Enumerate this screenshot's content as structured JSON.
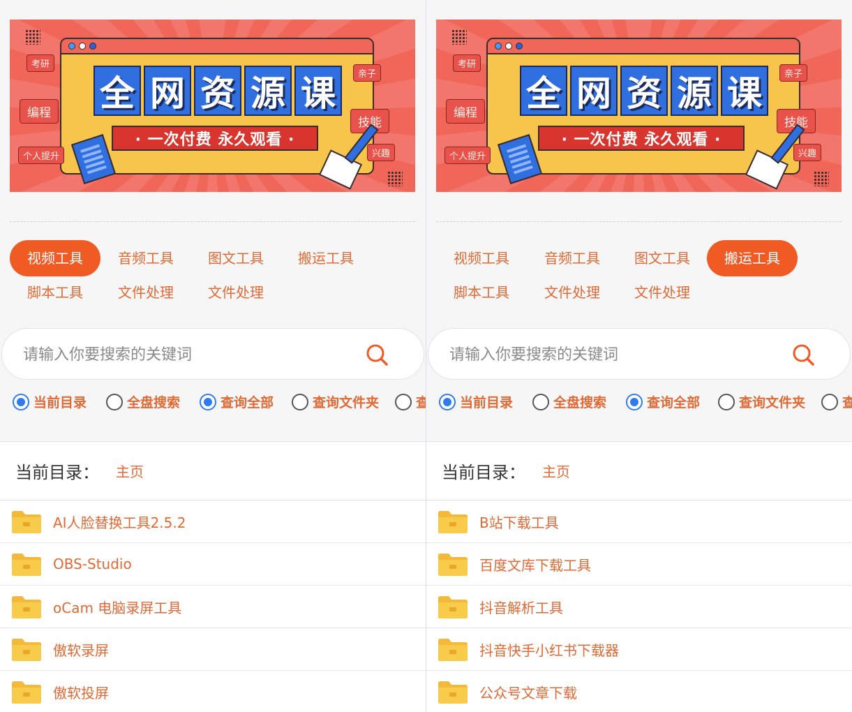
{
  "banner": {
    "title_chars": [
      "全",
      "网",
      "资",
      "源",
      "课"
    ],
    "slogan": "· 一次付费  永久观看 ·",
    "bubbles": [
      "考研",
      "编程",
      "个人提升",
      "亲子",
      "技能",
      "兴趣"
    ]
  },
  "tabs": [
    "视频工具",
    "音频工具",
    "图文工具",
    "搬运工具",
    "脚本工具",
    "文件处理",
    "文件处理"
  ],
  "search": {
    "placeholder": "请输入你要搜索的关键词",
    "icon": "search-icon"
  },
  "radio_options": [
    "当前目录",
    "全盘搜索",
    "查询全部",
    "查询文件夹",
    "查"
  ],
  "breadcrumb": {
    "label": "当前目录：",
    "home": "主页"
  },
  "colors": {
    "accent": "#f05a23",
    "text_accent": "#e06a35",
    "radio_blue": "#2f7bf0",
    "folder": "#f8cc4a"
  },
  "panels": [
    {
      "active_tab": "视频工具",
      "radios_checked": [
        "当前目录",
        "查询全部"
      ],
      "files": [
        "AI人脸替换工具2.5.2",
        "OBS-Studio",
        "oCam 电脑录屏工具",
        "傲软录屏",
        "傲软投屏"
      ]
    },
    {
      "active_tab": "搬运工具",
      "radios_checked": [
        "当前目录",
        "查询全部"
      ],
      "files": [
        "B站下载工具",
        "百度文库下载工具",
        "抖音解析工具",
        "抖音快手小红书下载器",
        "公众号文章下载"
      ]
    }
  ]
}
